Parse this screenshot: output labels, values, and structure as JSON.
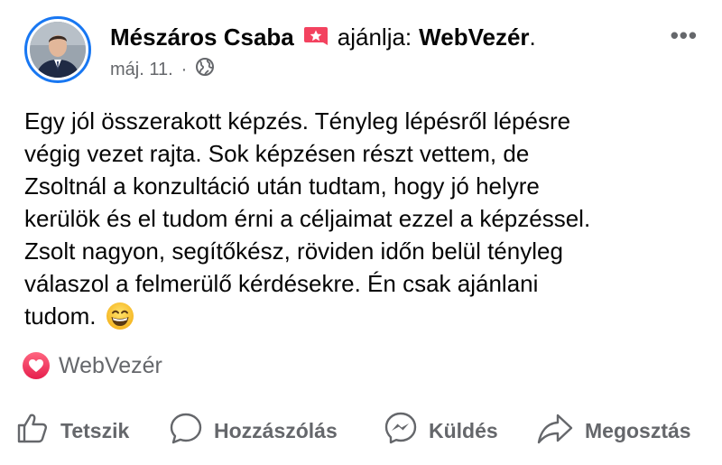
{
  "post": {
    "author": "Mészáros Csaba",
    "verb": "ajánlja:",
    "page": "WebVezér",
    "more_label": "•••",
    "date": "máj. 11.",
    "separator": "·",
    "audience_icon": "globe-icon",
    "recommend_icon": "star-badge-icon",
    "body_lines": [
      "Egy jól összerakott képzés. Tényleg lépésről lépésre",
      "végig vezet rajta. Sok képzésen részt vettem, de",
      "Zsoltnál a konzultáció után tudtam, hogy jó helyre",
      "kerülök és el tudom érni a céljaimat ezzel a képzéssel.",
      "Zsolt nagyon, segítőkész, röviden időn belül tényleg",
      "válaszol a felmerülő kérdésekre. Én csak ajánlani",
      "tudom."
    ],
    "emoji": "grinning-face-emoji"
  },
  "reaction": {
    "icon": "heart-icon",
    "label": "WebVezér"
  },
  "actions": {
    "like": "Tetszik",
    "comment": "Hozzászólás",
    "send": "Küldés",
    "share": "Megosztás"
  },
  "colors": {
    "accent": "#1877f2",
    "recommend": "#f3425f",
    "secondary_text": "#65676b"
  }
}
